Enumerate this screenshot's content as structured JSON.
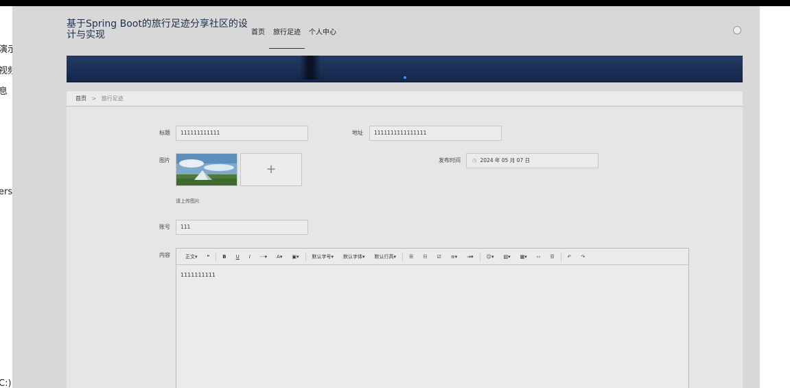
{
  "left_strip": {
    "texts": [
      "演示",
      "视频",
      "息",
      "ers",
      "C:)"
    ]
  },
  "header": {
    "title": "基于Spring Boot的旅行足迹分享社区的设计与实现",
    "nav": [
      "首页",
      "旅行足迹",
      "个人中心"
    ],
    "active_nav": "旅行足迹"
  },
  "breadcrumb": {
    "home": "首页",
    "sep": ">",
    "current": "旅行足迹"
  },
  "form": {
    "title_label": "标题",
    "title_value": "111111111111",
    "address_label": "地址",
    "address_value": "1111111111111111",
    "image_label": "图片",
    "upload_hint": "请上传图片",
    "upload_plus": "+",
    "publish_label": "发布时间",
    "publish_value": "2024 年 05 月 07 日",
    "account_label": "账号",
    "account_value": "111",
    "content_label": "内容",
    "content_value": "1111111111"
  },
  "toolbar": {
    "paragraph": "正文▾",
    "quote": "❝",
    "bold": "B",
    "underline": "U",
    "italic": "I",
    "more": "···▾",
    "font_color": "A▾",
    "bg_color": "▣▾",
    "font_size": "默认字号▾",
    "font_family": "默认字体▾",
    "line_height": "默认行高▾",
    "bullet_list": "☰",
    "num_list": "☷",
    "todo": "☑",
    "align": "≡▾",
    "indent": "⇥▾",
    "emoji": "☺▾",
    "image": "▨▾",
    "table": "▦▾",
    "code": "‹›",
    "divider": "☲",
    "undo": "↶",
    "redo": "↷"
  },
  "colors": {
    "banner": "#1c3360",
    "accent_dot": "#4b8ee8",
    "header_title": "#1f2d4d"
  }
}
